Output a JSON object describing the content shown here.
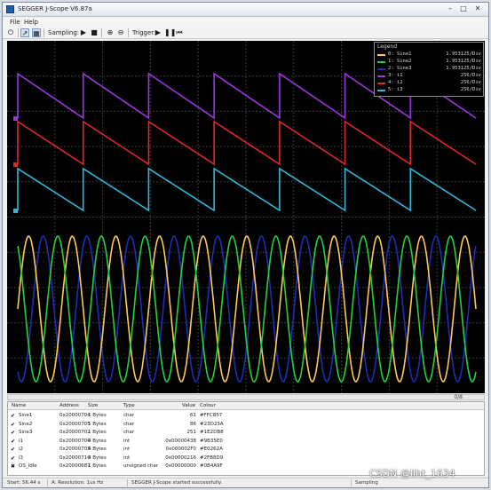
{
  "window": {
    "title": "SEGGER J-Scope V6.87a"
  },
  "menu": {
    "items": [
      "File",
      "Help"
    ]
  },
  "toolbar": {
    "sampling_label": "Sampling:",
    "trigger_label": "Trigger:"
  },
  "scope": {
    "background": "#000000",
    "grid_color": "#3a3a3a",
    "grid": true
  },
  "legend": {
    "title": "Legend",
    "entries": [
      {
        "name": "0: Sine1",
        "scale": "1.953125/Div",
        "color": "#FFC857"
      },
      {
        "name": "1: Sine2",
        "scale": "1.953125/Div",
        "color": "#23D23A"
      },
      {
        "name": "2: Sine3",
        "scale": "1.953125/Div",
        "color": "#1E2DB8"
      },
      {
        "name": "3: i1",
        "scale": "256/Div",
        "color": "#9B35E0"
      },
      {
        "name": "4: i2",
        "scale": "256/Div",
        "color": "#E0262A"
      },
      {
        "name": "5: i3",
        "scale": "256/Div",
        "color": "#2FB8D9"
      }
    ]
  },
  "chart_data": {
    "type": "line",
    "title": "",
    "xlabel": "",
    "ylabel": "",
    "grid": true,
    "legend_position": "top-right",
    "series": [
      {
        "name": "3: i1",
        "shape": "sawtooth",
        "periods": 7,
        "color": "#9B35E0"
      },
      {
        "name": "4: i2",
        "shape": "sawtooth",
        "periods": 7,
        "color": "#E0262A"
      },
      {
        "name": "5: i3",
        "shape": "sawtooth",
        "periods": 7,
        "color": "#2FB8D9"
      },
      {
        "name": "0: Sine1",
        "shape": "sine",
        "periods": 10.5,
        "phase_deg": 0,
        "color": "#FFC857"
      },
      {
        "name": "1: Sine2",
        "shape": "sine",
        "periods": 10.5,
        "phase_deg": 120,
        "color": "#23D23A"
      },
      {
        "name": "2: Sine3",
        "shape": "sine",
        "periods": 10.5,
        "phase_deg": 240,
        "color": "#1E2DB8"
      }
    ]
  },
  "scrollbar": {
    "label": "0/8"
  },
  "variables": {
    "headers": [
      "Name",
      "Address",
      "Size",
      "Type",
      "Value",
      "Colour"
    ],
    "rows": [
      {
        "checked": true,
        "name": "Sine1",
        "address": "0x20000704",
        "size": "1 Bytes",
        "type": "char",
        "value": "61",
        "colour": "#FFC857"
      },
      {
        "checked": true,
        "name": "Sine2",
        "address": "0x20000705",
        "size": "1 Bytes",
        "type": "char",
        "value": "86",
        "colour": "#23D23A"
      },
      {
        "checked": true,
        "name": "Sine3",
        "address": "0x20000702",
        "size": "1 Bytes",
        "type": "char",
        "value": "251",
        "colour": "#1E2DB8"
      },
      {
        "checked": true,
        "name": "i1",
        "address": "0x20000700",
        "size": "4 Bytes",
        "type": "int",
        "value": "0x00000438",
        "colour": "#9B35E0"
      },
      {
        "checked": true,
        "name": "i2",
        "address": "0x20000705",
        "size": "4 Bytes",
        "type": "int",
        "value": "0x000002F0",
        "colour": "#E0262A"
      },
      {
        "checked": true,
        "name": "i3",
        "address": "0x20000710",
        "size": "4 Bytes",
        "type": "int",
        "value": "0x00000216",
        "colour": "#2FB8D9"
      },
      {
        "checked": false,
        "name": "OS_Idle",
        "address": "0x20000687",
        "size": "1 Bytes",
        "type": "unsigned char",
        "value": "0x00000000",
        "colour": "#0B4A9F"
      }
    ]
  },
  "status": {
    "left": "Start: 56.44 s",
    "middle": "A: Resolution: 1us Hz",
    "right_msg": "SEGGER J-Scope started successfully.",
    "far_right": "Sampling"
  },
  "watermark": "CSDN @liht_1634"
}
